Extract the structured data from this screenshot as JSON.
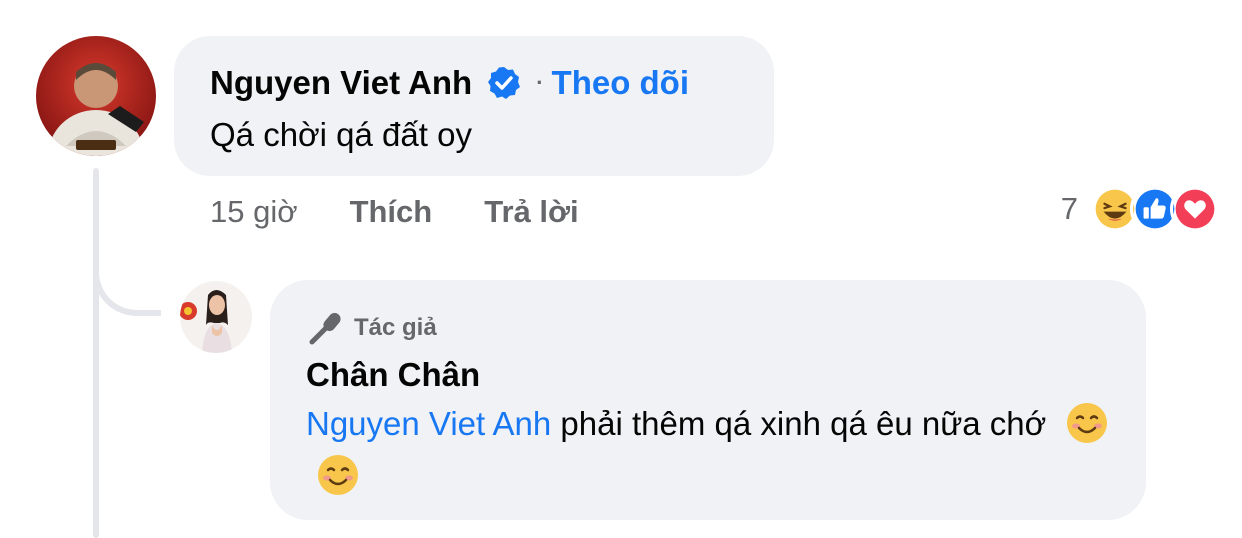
{
  "comment": {
    "author": "Nguyen Viet Anh",
    "follow_label": "Theo dõi",
    "dot": "·",
    "text": "Qá chời qá đất oy",
    "avatar_icon": "profile-photo",
    "verified_icon": "verified-badge-icon",
    "timestamp": "15 giờ",
    "like_label": "Thích",
    "reply_label": "Trả lời",
    "reaction_count": "7",
    "reactions": [
      "haha",
      "like",
      "love"
    ]
  },
  "reply": {
    "badge_label": "Tác giả",
    "badge_icon": "microphone-icon",
    "author": "Chân Chân",
    "mention": "Nguyen Viet Anh",
    "text": " phải thêm qá xinh qá êu nữa chớ",
    "emojis": [
      "smiling-face",
      "smiling-face"
    ]
  },
  "colors": {
    "link": "#1877f2",
    "bubble": "#f0f2f5",
    "secondary_text": "#65676b"
  }
}
